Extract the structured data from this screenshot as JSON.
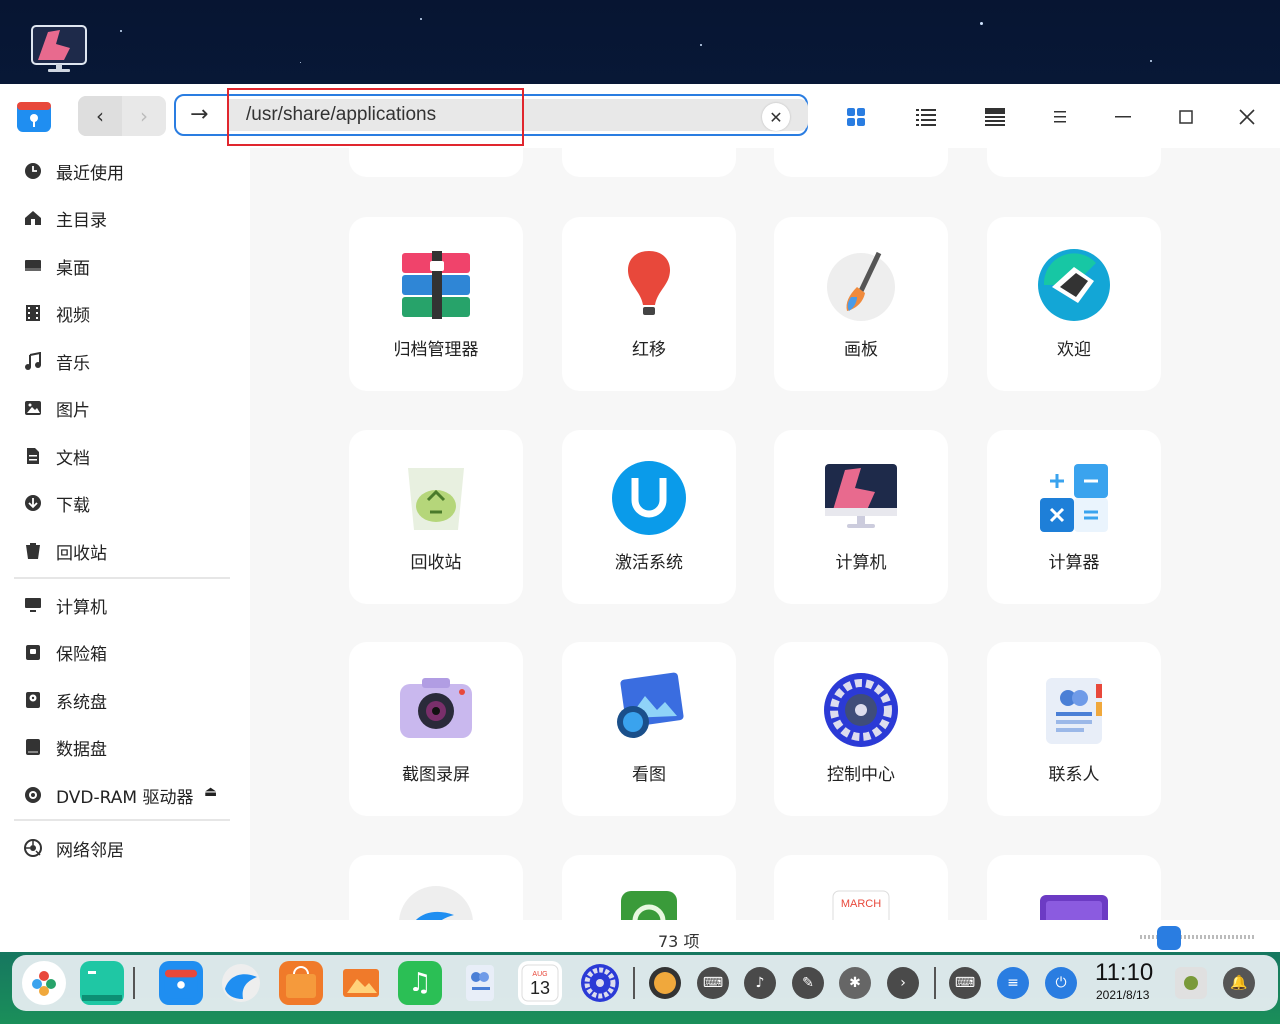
{
  "window": {
    "address": "/usr/share/applications"
  },
  "sidebar": {
    "items": [
      {
        "label": "最近使用",
        "icon": "clock-icon"
      },
      {
        "label": "主目录",
        "icon": "home-icon"
      },
      {
        "label": "桌面",
        "icon": "desktop-icon"
      },
      {
        "label": "视频",
        "icon": "video-icon"
      },
      {
        "label": "音乐",
        "icon": "music-icon"
      },
      {
        "label": "图片",
        "icon": "picture-icon"
      },
      {
        "label": "文档",
        "icon": "document-icon"
      },
      {
        "label": "下载",
        "icon": "download-icon"
      },
      {
        "label": "回收站",
        "icon": "trash-icon"
      },
      {
        "label": "计算机",
        "icon": "computer-icon"
      },
      {
        "label": "保险箱",
        "icon": "vault-icon"
      },
      {
        "label": "系统盘",
        "icon": "disk-icon"
      },
      {
        "label": "数据盘",
        "icon": "disk-icon"
      },
      {
        "label": "DVD-RAM 驱动器",
        "icon": "disc-icon"
      },
      {
        "label": "网络邻居",
        "icon": "network-icon"
      }
    ]
  },
  "apps": [
    {
      "label": "归档管理器",
      "icon": "archive-manager-icon"
    },
    {
      "label": "红移",
      "icon": "redshift-icon"
    },
    {
      "label": "画板",
      "icon": "draw-icon"
    },
    {
      "label": "欢迎",
      "icon": "welcome-icon"
    },
    {
      "label": "回收站",
      "icon": "trash-app-icon"
    },
    {
      "label": "激活系统",
      "icon": "activation-icon"
    },
    {
      "label": "计算机",
      "icon": "computer-app-icon"
    },
    {
      "label": "计算器",
      "icon": "calculator-icon"
    },
    {
      "label": "截图录屏",
      "icon": "screenshot-icon"
    },
    {
      "label": "看图",
      "icon": "image-viewer-icon"
    },
    {
      "label": "控制中心",
      "icon": "control-center-icon"
    },
    {
      "label": "联系人",
      "icon": "contacts-icon"
    }
  ],
  "status": {
    "count": "73 项"
  },
  "clock": {
    "time": "11:10",
    "date": "2021/8/13"
  },
  "calendar_day": "13",
  "calendar_month": "AUG",
  "partial_calendar_month": "MARCH",
  "colors": {
    "accent": "#2a7de1",
    "highlight": "#e0262e"
  }
}
